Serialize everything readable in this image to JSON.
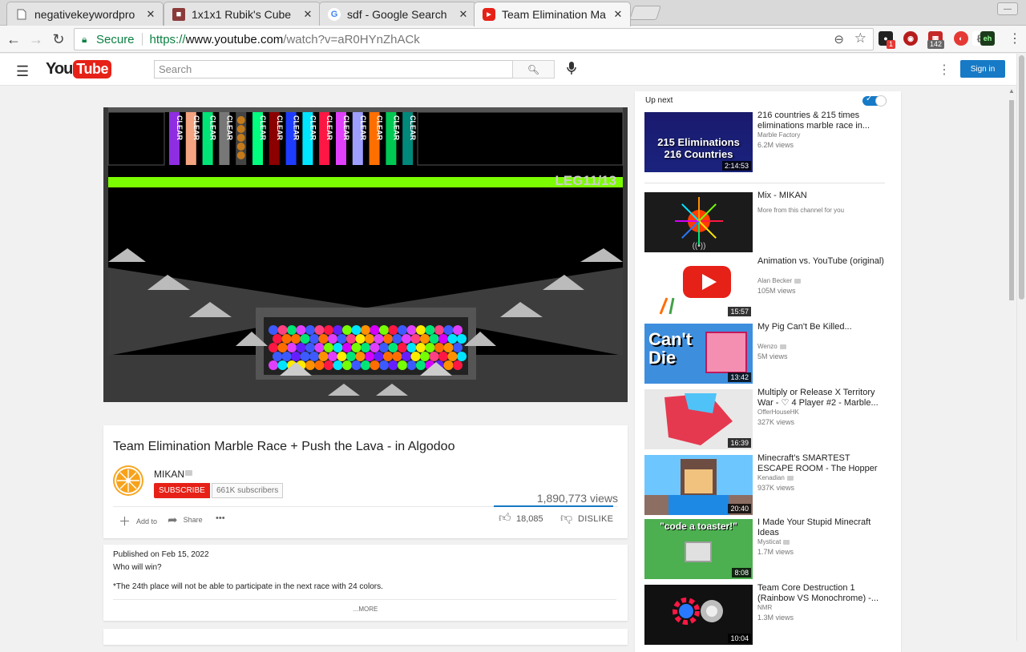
{
  "browser": {
    "tabs": [
      {
        "title": "negativekeywordpro",
        "favicon": "page-icon",
        "active": false
      },
      {
        "title": "1x1x1 Rubik's Cube",
        "favicon": "cube-icon",
        "active": false
      },
      {
        "title": "sdf - Google Search",
        "favicon": "google-icon",
        "active": false
      },
      {
        "title": "Team Elimination Ma",
        "favicon": "youtube-icon",
        "active": true
      }
    ],
    "address": {
      "secure_label": "Secure",
      "scheme": "https://",
      "host": "www.youtube.com",
      "path": "/watch?v=aR0HYnZhACk"
    },
    "extensions": [
      {
        "name": "ext-ghostery-icon",
        "badge": "1",
        "color": "#222"
      },
      {
        "name": "ext-red-circle-icon",
        "badge": "",
        "color": "#b71c1c"
      },
      {
        "name": "ext-calendar-icon",
        "badge": "142",
        "color": "#c62828"
      },
      {
        "name": "ext-pocket-icon",
        "badge": "",
        "color": "#e53935"
      },
      {
        "name": "ext-ie-icon",
        "badge": "",
        "color": "#777"
      },
      {
        "name": "ext-eh-icon",
        "badge": "",
        "color": "#1b3b1b",
        "text": "eh"
      }
    ]
  },
  "youtube": {
    "logo_you": "You",
    "logo_tube": "Tube",
    "search_placeholder": "Search",
    "signin_label": "Sign in",
    "brand_red": "#e62117",
    "brand_blue": "#167ac6"
  },
  "player": {
    "overlay_text": "LEG11/13",
    "clear_label": "CLEAR",
    "tube_colors": [
      "#8e2de2",
      "#f4a480",
      "#00e676",
      "#777777",
      "#444444",
      "#00ff7f",
      "#8b0000",
      "#1e3cff",
      "#00e5ff",
      "#ff1744",
      "#e040fb",
      "#9e9eff",
      "#ff6f00",
      "#00c853",
      "#00897b"
    ]
  },
  "video": {
    "title": "Team Elimination Marble Race + Push the Lava - in Algodoo",
    "channel": "MIKAN",
    "subscribe_label": "SUBSCRIBE",
    "subscribers": "661K subscribers",
    "views": "1,890,773 views",
    "add_to_label": "Add to",
    "share_label": "Share",
    "more_label": "•••",
    "likes": "18,085",
    "dislike_label": "DISLIKE",
    "like_ratio": 0.96
  },
  "description": {
    "published": "Published on Feb 15, 2022",
    "line1": "Who will win?",
    "line2": "*The 24th place will not be able to participate in the next race with 24 colors.",
    "more": "...MORE"
  },
  "sidebar": {
    "up_next_label": "Up next",
    "autoplay_on": true,
    "videos": [
      {
        "title": "216 countries & 215 times eliminations marble race in...",
        "channel": "Marble Factory",
        "verified": false,
        "views": "6.2M views",
        "duration": "2:14:53",
        "thumb_text": "215 Eliminations 216 Countries"
      },
      {
        "title": "Mix - MIKAN",
        "channel": "More from this channel for you",
        "verified": false,
        "views": "",
        "duration": "",
        "thumb_text": ""
      },
      {
        "title": "Animation vs. YouTube (original)",
        "channel": "Alan Becker",
        "verified": true,
        "views": "105M views",
        "duration": "15:57",
        "thumb_text": ""
      },
      {
        "title": "My Pig Can't Be Killed...",
        "channel": "Wenzo",
        "verified": true,
        "views": "5M views",
        "duration": "13:42",
        "thumb_text": "Can't Die"
      },
      {
        "title": "Multiply or Release X Territory War - ♡ 4 Player #2 - Marble...",
        "channel": "OfferHouseHK",
        "verified": false,
        "views": "327K views",
        "duration": "16:39",
        "thumb_text": ""
      },
      {
        "title": "Minecraft's SMARTEST ESCAPE ROOM - The Hopper",
        "channel": "Kenadian",
        "verified": true,
        "views": "937K views",
        "duration": "20:40",
        "thumb_text": ""
      },
      {
        "title": "I Made Your Stupid Minecraft Ideas",
        "channel": "Mysticat",
        "verified": true,
        "views": "1.7M views",
        "duration": "8:08",
        "thumb_text": "\"code a toaster!\""
      },
      {
        "title": "Team Core Destruction 1 (Rainbow VS Monochrome) -...",
        "channel": "NMR",
        "verified": false,
        "views": "1.3M views",
        "duration": "10:04",
        "thumb_text": ""
      }
    ]
  }
}
